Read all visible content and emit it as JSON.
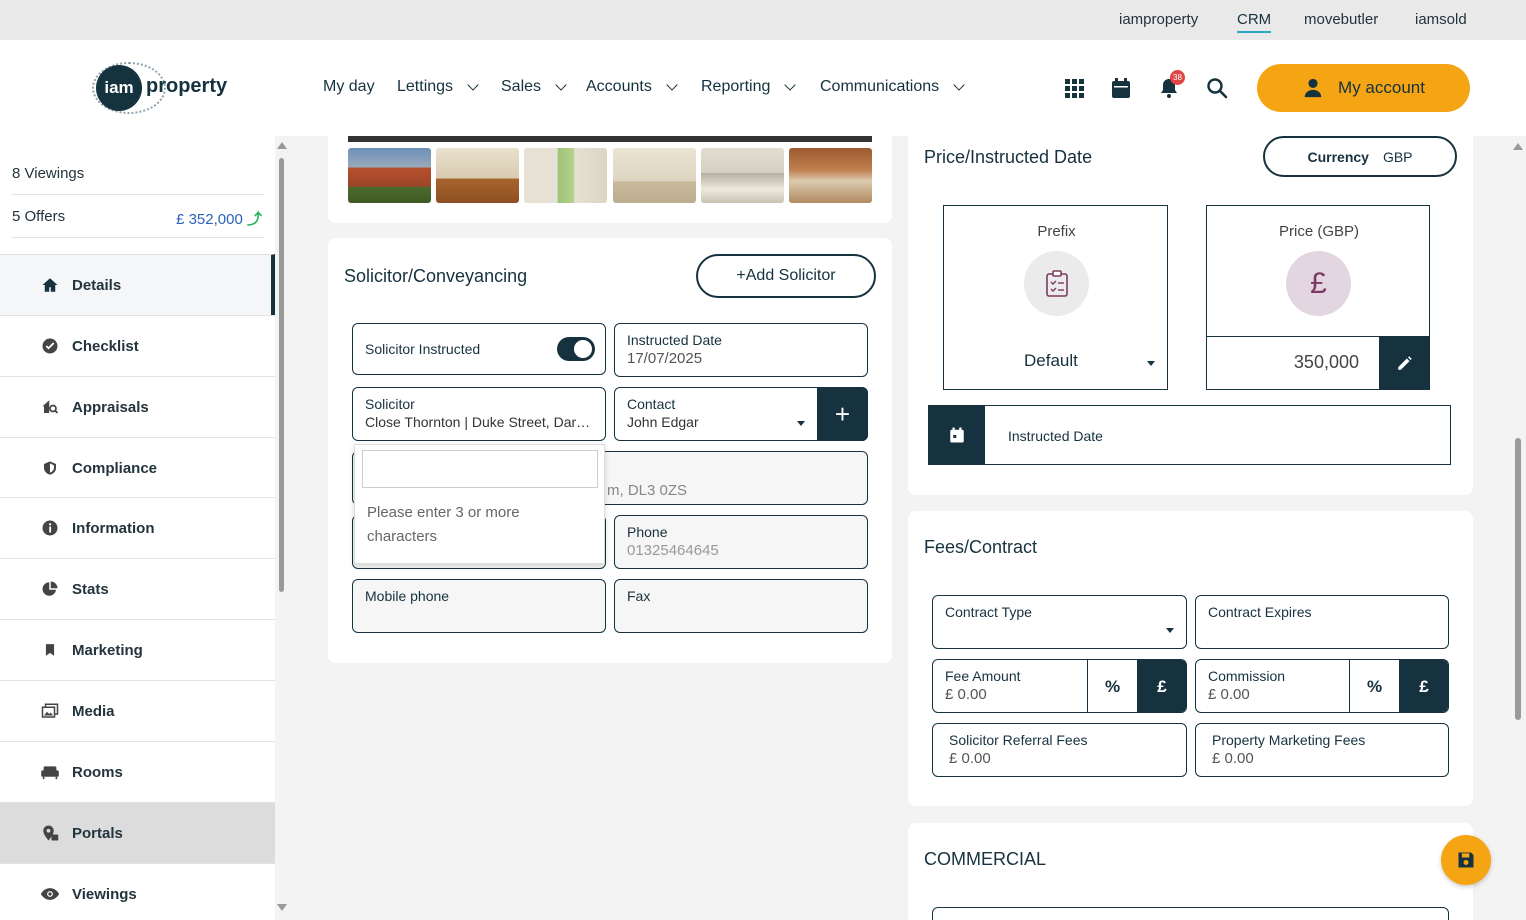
{
  "top_links": [
    "iamproperty",
    "CRM",
    "movebutler",
    "iamsold"
  ],
  "logo": {
    "icon_text": "iam",
    "text": "property"
  },
  "nav": {
    "items": [
      "My day",
      "Lettings",
      "Sales",
      "Accounts",
      "Reporting",
      "Communications"
    ],
    "notification_count": "38",
    "account_label": "My account"
  },
  "sidebar": {
    "viewings": "8 Viewings",
    "offers": "5 Offers",
    "offer_value": "£ 352,000",
    "items": [
      {
        "label": "Details",
        "icon": "home-icon"
      },
      {
        "label": "Checklist",
        "icon": "check-circle-icon"
      },
      {
        "label": "Appraisals",
        "icon": "house-search-icon"
      },
      {
        "label": "Compliance",
        "icon": "shield-icon"
      },
      {
        "label": "Information",
        "icon": "info-icon"
      },
      {
        "label": "Stats",
        "icon": "pie-chart-icon"
      },
      {
        "label": "Marketing",
        "icon": "bookmark-icon"
      },
      {
        "label": "Media",
        "icon": "images-icon"
      },
      {
        "label": "Rooms",
        "icon": "sofa-icon"
      },
      {
        "label": "Portals",
        "icon": "portal-icon"
      },
      {
        "label": "Viewings",
        "icon": "eye-icon"
      }
    ]
  },
  "solicitor": {
    "title": "Solicitor/Conveyancing",
    "add_button": "+Add Solicitor",
    "instructed_label": "Solicitor Instructed",
    "instructed_date_label": "Instructed Date",
    "instructed_date_value": "17/07/2025",
    "solicitor_label": "Solicitor",
    "solicitor_value": "Close Thornton | Duke Street, Darlington",
    "contact_label": "Contact",
    "contact_value": "John Edgar",
    "address_partial": "m, DL3 0ZS",
    "phone_label": "Phone",
    "phone_value": "01325464645",
    "mobile_label": "Mobile phone",
    "fax_label": "Fax",
    "dropdown_message": "Please enter 3 or more characters"
  },
  "price": {
    "title": "Price/Instructed Date",
    "currency_label": "Currency",
    "currency_value": "GBP",
    "prefix_label": "Prefix",
    "prefix_value": "Default",
    "price_label": "Price (GBP)",
    "price_symbol": "£",
    "price_value": "350,000",
    "instructed_date_label": "Instructed Date"
  },
  "fees": {
    "title": "Fees/Contract",
    "contract_type_label": "Contract Type",
    "contract_expires_label": "Contract Expires",
    "fee_amount_label": "Fee Amount",
    "fee_amount_value": "£ 0.00",
    "commission_label": "Commission",
    "commission_value": "£ 0.00",
    "percent_symbol": "%",
    "pound_symbol": "£",
    "referral_label": "Solicitor Referral Fees",
    "referral_value": "£ 0.00",
    "marketing_label": "Property Marketing Fees",
    "marketing_value": "£ 0.00"
  },
  "commercial": {
    "title": "COMMERCIAL"
  },
  "colors": {
    "primary": "#16323f",
    "accent": "#f5a413",
    "link": "#2d62b8"
  }
}
